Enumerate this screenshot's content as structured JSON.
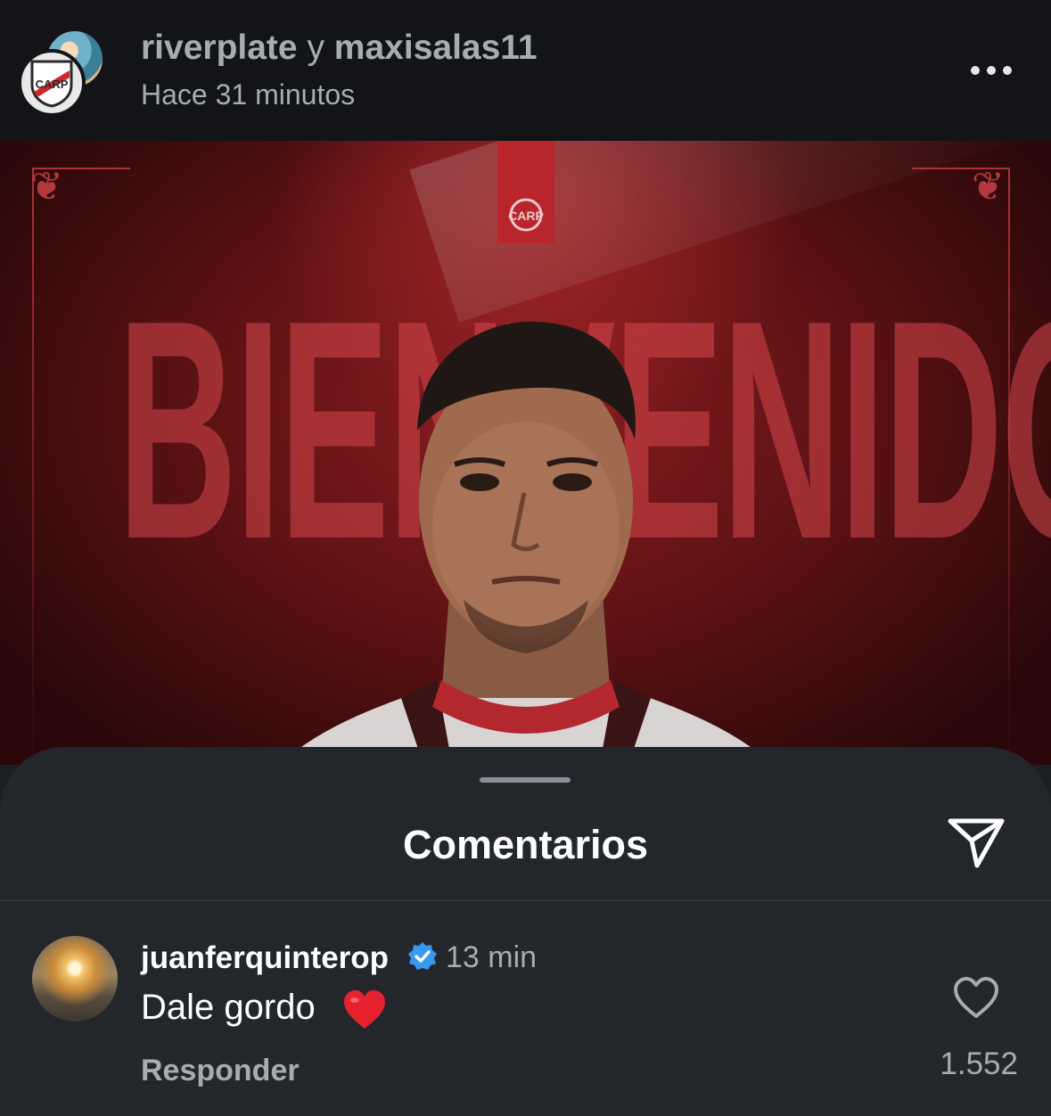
{
  "header": {
    "account_1": "riverplate",
    "connector": "y",
    "account_2": "maxisalas11",
    "time": "Hace 31 minutos",
    "more_icon": "more-horizontal-icon"
  },
  "post": {
    "headline": "BIENVENIDO",
    "crest_icon": "river-plate-crest"
  },
  "comments_sheet": {
    "title": "Comentarios",
    "send_icon": "paper-plane-icon"
  },
  "comment": {
    "username": "juanferquinterop",
    "verified": true,
    "time": "13 min",
    "text": "Dale gordo",
    "emoji": "red-heart",
    "reply_label": "Responder",
    "likes": "1.552",
    "like_icon": "heart-outline-icon"
  },
  "colors": {
    "background": "#1c1e22",
    "topbar": "#121418",
    "sheet": "#23262b",
    "secondary_text": "#a8abb0",
    "verified_blue": "#3897f0",
    "brand_red": "#b8262b"
  }
}
